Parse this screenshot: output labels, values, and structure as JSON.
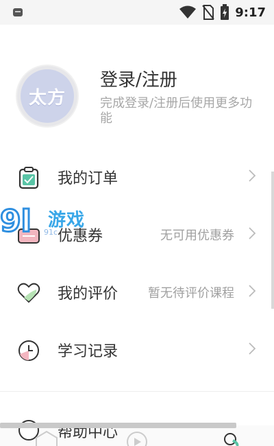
{
  "status": {
    "time": "9:17"
  },
  "profile": {
    "avatar_text": "太方",
    "title": "登录/注册",
    "subtitle": "完成登录/注册后使用更多功能"
  },
  "menu": [
    {
      "label": "我的订单",
      "hint": "",
      "icon": "clipboard-icon"
    },
    {
      "label": "优惠券",
      "hint": "无可用优惠券",
      "icon": "coupon-icon"
    },
    {
      "label": "我的评价",
      "hint": "暂无待评价课程",
      "icon": "heart-icon"
    },
    {
      "label": "学习记录",
      "hint": "",
      "icon": "clock-icon"
    }
  ],
  "bottom_item": {
    "label": "帮助中心"
  },
  "watermark": {
    "num": "9l",
    "text": "游戏",
    "small": "91c"
  },
  "colors": {
    "accent_green": "#59c4a6",
    "accent_pink": "#f3b6c0",
    "avatar_blue": "#cdd3ea"
  }
}
